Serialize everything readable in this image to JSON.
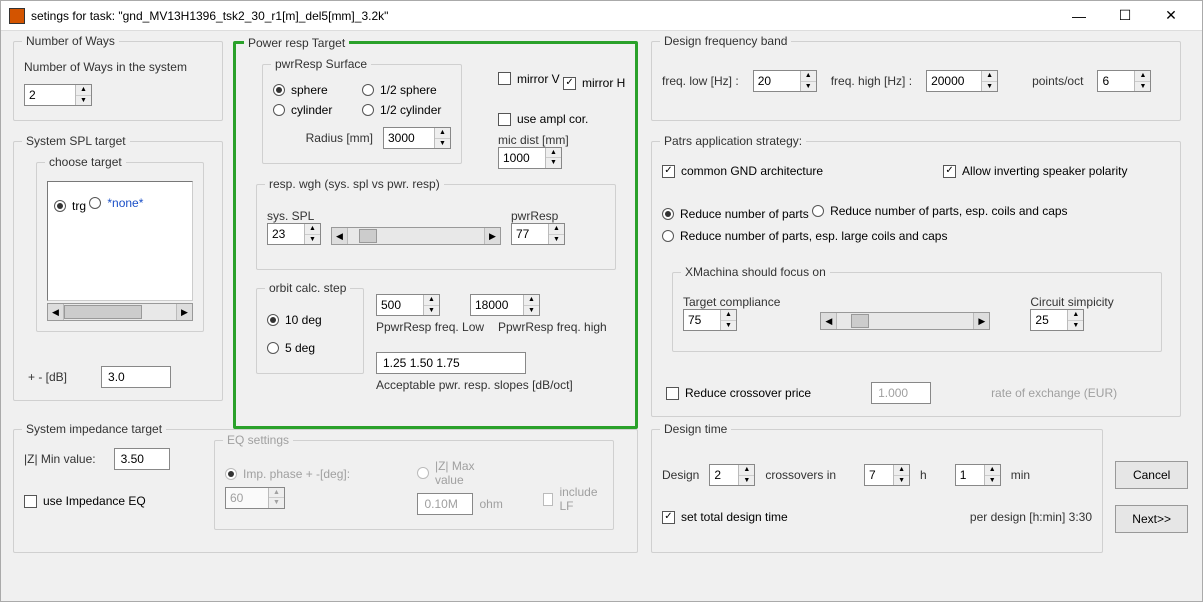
{
  "titlebar": {
    "text": "setings for task: \"gnd_MV13H1396_tsk2_30_r1[m]_del5[mm]_3.2k\""
  },
  "numberOfWays": {
    "legend": "Number of Ways",
    "label": "Number of Ways in the system",
    "value": "2"
  },
  "systemSplTarget": {
    "legend": "System SPL target",
    "chooseTarget": {
      "legend": "choose target",
      "opt_trg": "trg",
      "opt_none": "*none*",
      "selected": "trg"
    },
    "plusminus_label": "+ - [dB]",
    "plusminus_value": "3.0"
  },
  "powerRespTarget": {
    "legend": "Power resp Target",
    "surface": {
      "legend": "pwrResp Surface",
      "sphere": "sphere",
      "half_sphere": "1/2 sphere",
      "cylinder": "cylinder",
      "half_cylinder": "1/2 cylinder",
      "radius_label": "Radius [mm]",
      "radius_value": "3000"
    },
    "mirrorV": "mirror V",
    "mirrorH": "mirror H",
    "useAmplCor": "use ampl cor.",
    "micDist_label": "mic dist [mm]",
    "micDist_value": "1000",
    "respWgh": {
      "legend": "resp. wgh (sys. spl vs pwr. resp)",
      "sysSPL_label": "sys. SPL",
      "sysSPL_value": "23",
      "pwrResp_label": "pwrResp",
      "pwrResp_value": "77"
    },
    "orbit": {
      "legend": "orbit calc. step",
      "ten": "10 deg",
      "five": "5 deg"
    },
    "freqLow_value": "500",
    "freqLow_label": "PpwrResp  freq. Low",
    "freqHigh_value": "18000",
    "freqHigh_label": "PpwrResp  freq. high",
    "slopes_value": "1.25 1.50 1.75",
    "slopes_label": "Acceptable pwr. resp. slopes [dB/oct]"
  },
  "designBand": {
    "legend": "Design frequency band",
    "low_label": "freq. low [Hz] :",
    "low_value": "20",
    "high_label": "freq. high [Hz] :",
    "high_value": "20000",
    "points_label": "points/oct",
    "points_value": "6"
  },
  "partsStrategy": {
    "legend": "Patrs application strategy:",
    "commonGnd": "common GND architecture",
    "allowInvert": "Allow inverting speaker polarity",
    "opt1": "Reduce number of parts",
    "opt2": "Reduce number of parts, esp. coils and caps",
    "opt3": "Reduce number of parts, esp. large coils and caps",
    "focus": {
      "legend": "XMachina should focus on",
      "target_label": "Target compliance",
      "target_value": "75",
      "circuit_label": "Circuit simpicity",
      "circuit_value": "25"
    },
    "reducePrice": "Reduce crossover price",
    "rate_value": "1.000",
    "rate_label": "rate of exchange (EUR)"
  },
  "impedance": {
    "legend": "System impedance target",
    "zmin_label": "|Z| Min value:",
    "zmin_value": "3.50",
    "useEQ": "use Impedance EQ",
    "eq": {
      "legend": "EQ settings",
      "impPhase": "Imp. phase + -[deg]:",
      "impPhase_value": "60",
      "zmax": "|Z| Max value",
      "zmax_value": "0.10M",
      "ohm": "ohm",
      "includeLF": "include LF"
    }
  },
  "designTime": {
    "legend": "Design time",
    "design_label": "Design",
    "design_value": "2",
    "crossovers_label": "crossovers in",
    "hours_value": "7",
    "h_label": "h",
    "min_value": "1",
    "min_label": "min",
    "setTotal": "set total design time",
    "perDesign_label": "per design [h:min]  3:30"
  },
  "buttons": {
    "cancel": "Cancel",
    "next": "Next>>"
  }
}
